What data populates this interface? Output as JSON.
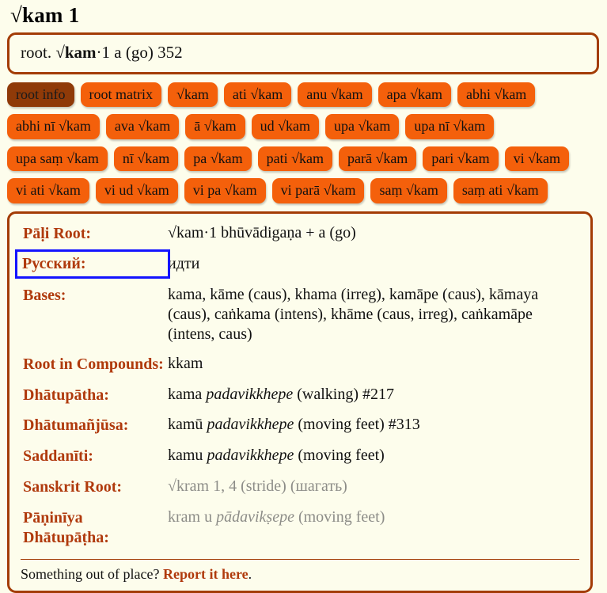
{
  "page": {
    "title": "√kam 1",
    "summary_prefix": "root. ",
    "summary_bold": "√kam",
    "summary_suffix": "·1 a (go) 352"
  },
  "tag_rows": [
    [
      {
        "label": "root info",
        "active": true
      },
      {
        "label": "root matrix",
        "active": false
      },
      {
        "label": "√kam",
        "active": false
      },
      {
        "label": "ati √kam",
        "active": false
      },
      {
        "label": "anu √kam",
        "active": false
      },
      {
        "label": "apa √kam",
        "active": false
      },
      {
        "label": "abhi √kam",
        "active": false
      }
    ],
    [
      {
        "label": "abhi nī √kam",
        "active": false
      },
      {
        "label": "ava √kam",
        "active": false
      },
      {
        "label": "ā √kam",
        "active": false
      },
      {
        "label": "ud √kam",
        "active": false
      },
      {
        "label": "upa √kam",
        "active": false
      },
      {
        "label": "upa nī √kam",
        "active": false
      }
    ],
    [
      {
        "label": "upa saṃ √kam",
        "active": false
      },
      {
        "label": "nī √kam",
        "active": false
      },
      {
        "label": "pa √kam",
        "active": false
      },
      {
        "label": "pati √kam",
        "active": false
      },
      {
        "label": "parā √kam",
        "active": false
      },
      {
        "label": "pari √kam",
        "active": false
      },
      {
        "label": "vi √kam",
        "active": false
      }
    ],
    [
      {
        "label": "vi ati √kam",
        "active": false
      },
      {
        "label": "vi ud √kam",
        "active": false
      },
      {
        "label": "vi pa √kam",
        "active": false
      },
      {
        "label": "vi parā √kam",
        "active": false
      },
      {
        "label": "saṃ √kam",
        "active": false
      },
      {
        "label": "saṃ ati √kam",
        "active": false
      }
    ]
  ],
  "detail_rows": [
    {
      "label": "Pāḷi Root:",
      "muted": false,
      "focused": false,
      "parts": [
        {
          "text": "√kam·1 bhūvādigaṇa + a (go)",
          "italic": false
        }
      ]
    },
    {
      "label": "Русский:",
      "muted": false,
      "focused": true,
      "parts": [
        {
          "text": "идти",
          "italic": false
        }
      ]
    },
    {
      "label": "Bases:",
      "muted": false,
      "focused": false,
      "parts": [
        {
          "text": "kama, kāme (caus), khama (irreg), kamāpe (caus), kāmaya (caus), caṅkama (intens), khāme (caus, irreg), caṅkamāpe (intens, caus)",
          "italic": false
        }
      ]
    },
    {
      "label": "Root in Compounds:",
      "muted": false,
      "focused": false,
      "parts": [
        {
          "text": "kkam",
          "italic": false
        }
      ]
    },
    {
      "label": "Dhātupātha:",
      "muted": false,
      "focused": false,
      "parts": [
        {
          "text": "kama ",
          "italic": false
        },
        {
          "text": "padavikkhepe",
          "italic": true
        },
        {
          "text": " (walking) #217",
          "italic": false
        }
      ]
    },
    {
      "label": "Dhātumañjūsa:",
      "muted": false,
      "focused": false,
      "parts": [
        {
          "text": "kamū ",
          "italic": false
        },
        {
          "text": "padavikkhepe",
          "italic": true
        },
        {
          "text": " (moving feet) #313",
          "italic": false
        }
      ]
    },
    {
      "label": "Saddanīti:",
      "muted": false,
      "focused": false,
      "parts": [
        {
          "text": "kamu ",
          "italic": false
        },
        {
          "text": "padavikkhepe",
          "italic": true
        },
        {
          "text": " (moving feet)",
          "italic": false
        }
      ]
    },
    {
      "label": "Sanskrit Root:",
      "muted": true,
      "focused": false,
      "parts": [
        {
          "text": "√kram 1, 4 (stride) (шагать)",
          "italic": false
        }
      ]
    },
    {
      "label": "Pāṇinīya Dhātupāṭha:",
      "muted": true,
      "focused": false,
      "parts": [
        {
          "text": "kram u ",
          "italic": false
        },
        {
          "text": "pādavikṣepe",
          "italic": true
        },
        {
          "text": " (moving feet)",
          "italic": false
        }
      ]
    }
  ],
  "footer": {
    "text_before": "Something out of place? ",
    "link_label": "Report it here",
    "text_after": "."
  },
  "colors": {
    "accent_orange": "#f4600b",
    "accent_active": "#8f3a08",
    "border_brown": "#a33c06",
    "label_rust": "#b03a0d",
    "background_cream": "#fdfdec",
    "focus_blue": "#1414ff",
    "muted_grey": "#8d8d88"
  }
}
